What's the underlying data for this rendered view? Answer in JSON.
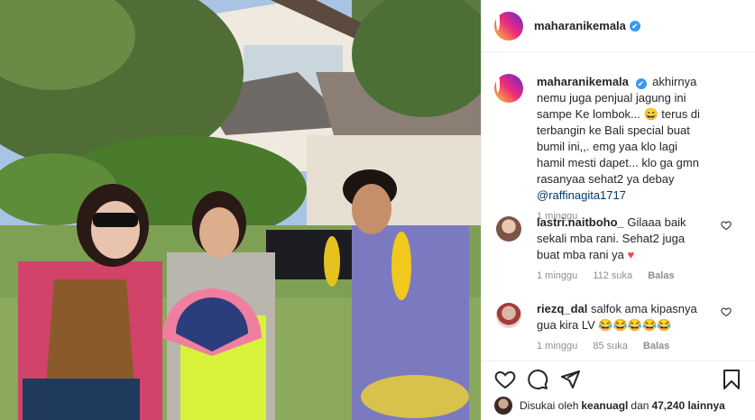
{
  "post": {
    "author": "maharanikemala",
    "verified_glyph": "✔"
  },
  "caption": {
    "author": "maharanikemala",
    "text": "akhirnya nemu juga penjual jagung ini sampe Ke lombok... 😄 terus di terbangin ke Bali special buat bumil ini,,. emg yaa klo lagi hamil mesti dapet... klo ga gmn rasanyaa sehat2 ya debay",
    "mention": "@raffinagita1717",
    "time": "1 minggu"
  },
  "comments": [
    {
      "author": "lastri.naitboho_",
      "text": "Gilaaa baik sekali mba rani. Sehat2 juga buat mba rani ya",
      "emoji": "♥",
      "time": "1 minggu",
      "likes": "112 suka",
      "reply": "Balas"
    },
    {
      "author": "riezq_dal",
      "text": "salfok ama kipasnya gua kira LV",
      "emoji": "😂😂😂😂😂",
      "time": "1 minggu",
      "likes": "85 suka",
      "reply": "Balas"
    }
  ],
  "likes_line": {
    "prefix": "Disukai oleh",
    "user": "keanuagl",
    "middle": "dan",
    "count": "47,240 lainnya"
  },
  "icons": {
    "like": "heart-icon",
    "comment": "comment-icon",
    "share": "share-icon",
    "save": "bookmark-icon"
  },
  "colors": {
    "verified": "#3897f0",
    "link": "#00376b",
    "muted": "#8e8e8e",
    "heart_red": "#ed4956"
  }
}
